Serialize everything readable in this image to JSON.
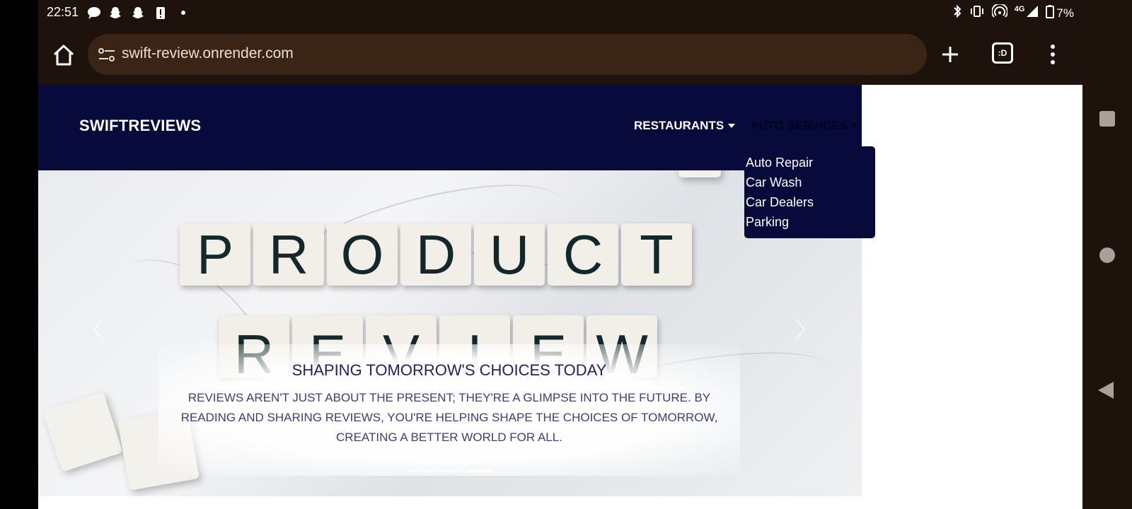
{
  "status_bar": {
    "time": "22:51",
    "network": "4G",
    "battery": "7%",
    "left_icons": [
      "chat-bubble-icon",
      "snapchat-icon",
      "snapchat-icon",
      "alert-icon",
      "dot-icon"
    ],
    "right_icons": [
      "bluetooth-icon",
      "vibrate-icon",
      "hotspot-icon",
      "signal-icon",
      "battery-icon"
    ]
  },
  "browser": {
    "url": "swift-review.onrender.com",
    "tab_switcher_label": ":D"
  },
  "site": {
    "brand": "SWIFTREVIEWS",
    "nav": {
      "restaurants": "RESTAURANTS",
      "auto_services": "AUTO SERVICES"
    },
    "dropdown": {
      "items": [
        "Auto Repair",
        "Car Wash",
        "Car Dealers",
        "Parking"
      ]
    },
    "hero": {
      "tiles_row1": [
        "P",
        "R",
        "O",
        "D",
        "U",
        "C",
        "T"
      ],
      "tiles_row2": [
        "R",
        "E",
        "V",
        "I",
        "E",
        "W"
      ],
      "caption_title": "SHAPING TOMORROW'S CHOICES TODAY",
      "caption_text": "REVIEWS AREN'T JUST ABOUT THE PRESENT; THEY'RE A GLIMPSE INTO THE FUTURE. BY READING AND SHARING REVIEWS, YOU'RE HELPING SHAPE THE CHOICES OF TOMORROW, CREATING A BETTER WORLD FOR ALL.",
      "active_slide": 3,
      "slide_count": 3
    }
  },
  "colors": {
    "chrome_bg": "#1e120c",
    "url_bar_bg": "#3a2416",
    "navbar_bg": "#070a3a",
    "caption_title": "#1f225e"
  }
}
